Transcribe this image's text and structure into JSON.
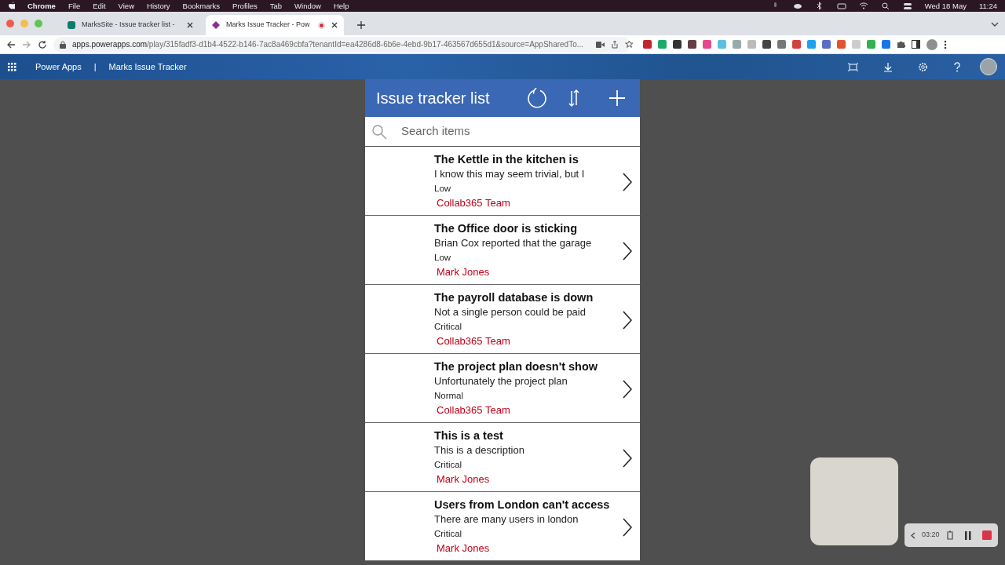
{
  "menubar": {
    "app": "Chrome",
    "menus": [
      "File",
      "Edit",
      "View",
      "History",
      "Bookmarks",
      "Profiles",
      "Tab",
      "Window",
      "Help"
    ],
    "date": "Wed 18 May",
    "time": "11:24"
  },
  "tabs": [
    {
      "title": "MarksSite - Issue tracker list -",
      "selected": false,
      "recording": false
    },
    {
      "title": "Marks Issue Tracker - Pow",
      "selected": true,
      "recording": true
    }
  ],
  "address": {
    "host": "apps.powerapps.com",
    "path": "/play/315fadf3-d1b4-4522-b146-7ac8a469cbfa?tenantId=ea4286d8-6b6e-4ebd-9b17-463567d655d1&source=AppSharedTo..."
  },
  "header": {
    "product": "Power Apps",
    "separator": "|",
    "app_name": "Marks Issue Tracker"
  },
  "app": {
    "title": "Issue tracker list",
    "search": {
      "placeholder": "Search items"
    },
    "items": [
      {
        "title": "The Kettle in the kitchen is",
        "description": "I know this may seem trivial, but I",
        "priority": "Low",
        "owner": "Collab365 Team"
      },
      {
        "title": "The Office door is sticking",
        "description": "Brian Cox reported that the garage",
        "priority": "Low",
        "owner": "Mark Jones"
      },
      {
        "title": "The payroll database is down",
        "description": "Not a single person could be paid",
        "priority": "Critical",
        "owner": "Collab365 Team"
      },
      {
        "title": "The project plan doesn't show",
        "description": "Unfortunately the project plan",
        "priority": "Normal",
        "owner": "Collab365 Team"
      },
      {
        "title": "This is a test",
        "description": "This is a description",
        "priority": "Critical",
        "owner": "Mark Jones"
      },
      {
        "title": "Users from London can't access",
        "description": "There are many users in london",
        "priority": "Critical",
        "owner": "Mark Jones"
      }
    ]
  },
  "recorder": {
    "time": "03:20"
  }
}
